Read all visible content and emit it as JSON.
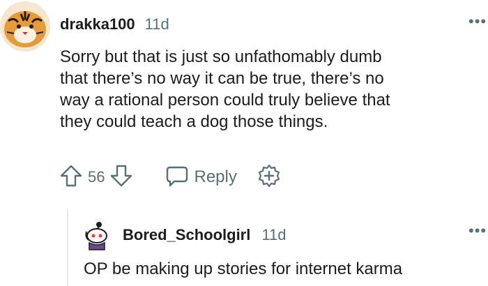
{
  "comments": [
    {
      "username": "drakka100",
      "age": "11d",
      "avatar_icon": "tiger-avatar-icon",
      "text_lines": [
        "Sorry but that is just so unfathomably dumb",
        "that there’s no way it can be true, there’s no",
        "way a rational person could truly believe that",
        "they could teach a dog those things."
      ],
      "vote_count": "56",
      "reply_label": "Reply",
      "overflow_icon": "more-options-icon"
    },
    {
      "username": "Bored_Schoolgirl",
      "age": "11d",
      "avatar_icon": "snoo-avatar-icon",
      "text_lines": [
        "OP be making up stories for internet karma"
      ],
      "overflow_icon": "more-options-icon"
    }
  ],
  "colors": {
    "text": "#1c1c1c",
    "meta": "#576f76",
    "thread_line": "#e5ebee"
  }
}
